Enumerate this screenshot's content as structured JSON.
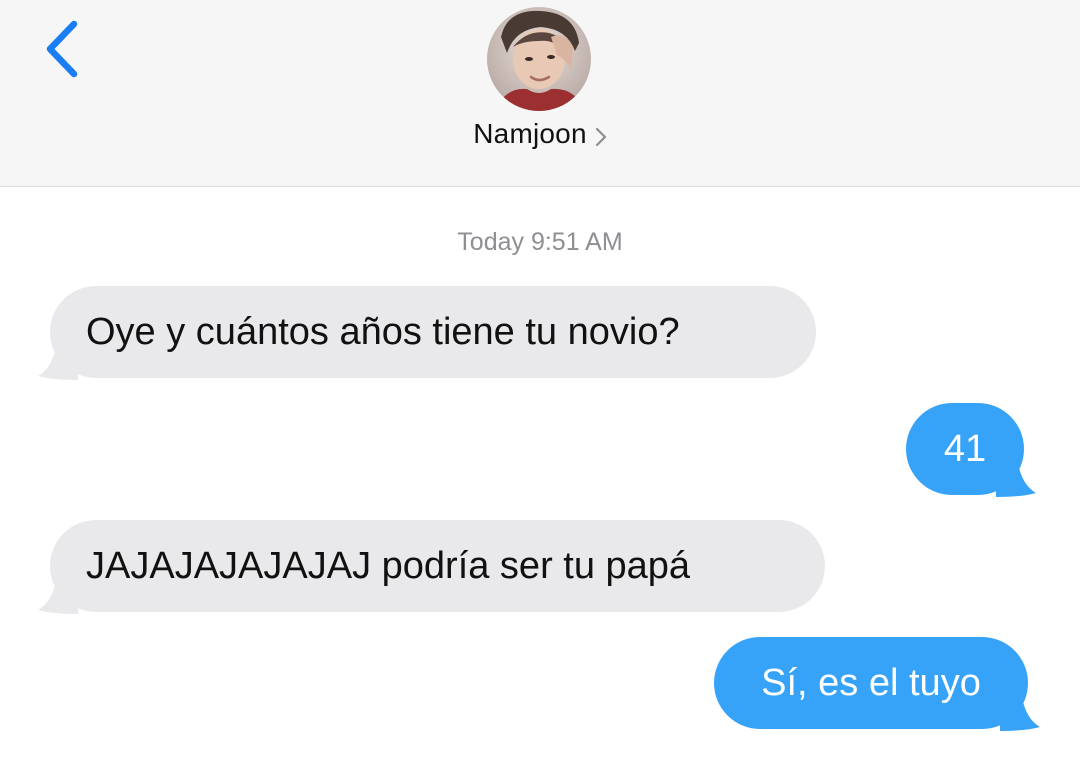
{
  "header": {
    "back_icon": "chevron-left-icon",
    "contact_name": "Namjoon",
    "contact_chevron_icon": "chevron-right-icon",
    "accent_color": "#1a7ef2"
  },
  "conversation": {
    "timestamp": "Today 9:51 AM",
    "messages": [
      {
        "direction": "received",
        "text": "Oye y cuántos años tiene tu novio?"
      },
      {
        "direction": "sent",
        "text": "41"
      },
      {
        "direction": "received",
        "text": "JAJAJAJAJAJAJ podría ser tu papá"
      },
      {
        "direction": "sent",
        "text": "Sí, es el tuyo"
      }
    ]
  },
  "colors": {
    "received_bubble": "#e9e9eb",
    "sent_bubble": "#36a3f9",
    "timestamp_text": "#8e8e93"
  }
}
